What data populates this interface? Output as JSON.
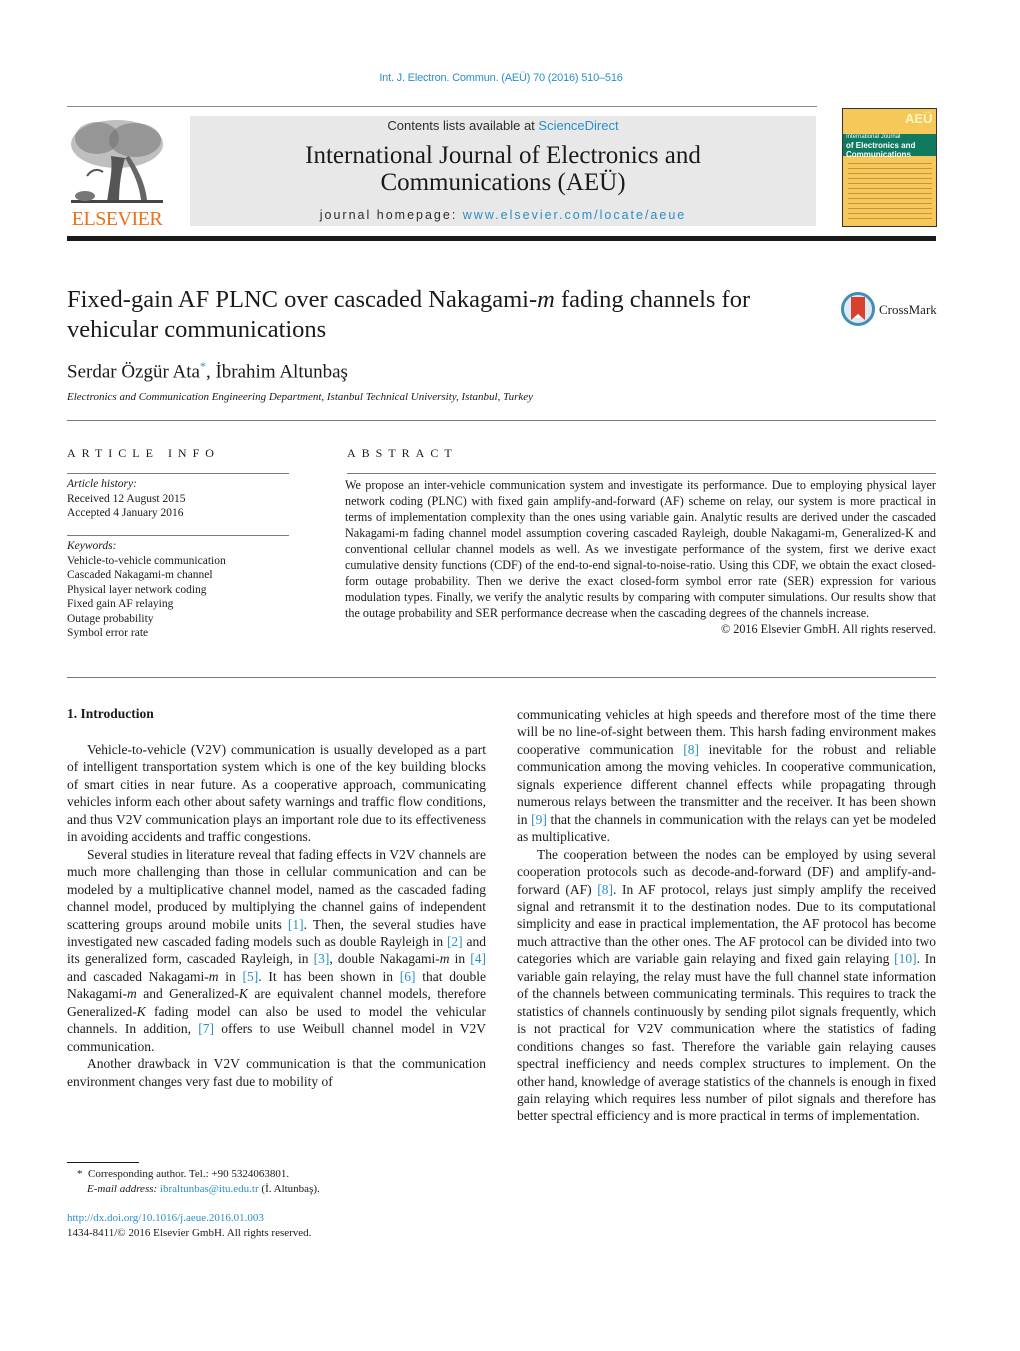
{
  "header": {
    "citation": "Int. J. Electron. Commun. (AEÜ) 70 (2016) 510–516",
    "contents_prefix": "Contents lists available at ",
    "contents_link": "ScienceDirect",
    "journal_title_line1": "International Journal of Electronics and",
    "journal_title_line2": "Communications (AEÜ)",
    "homepage_prefix": "journal homepage: ",
    "homepage_link": "www.elsevier.com/locate/aeue",
    "publisher_logo_text": "ELSEVIER",
    "cover": {
      "badge": "AEÜ",
      "title_line1": "International Journal",
      "title_line2": "of Electronics and",
      "title_line3": "Communications"
    },
    "colors": {
      "link": "#2a8fc7",
      "elsevier_orange": "#e9711c",
      "banner_bg": "#e8e8e8",
      "cover_yellow": "#f6c85a",
      "cover_green": "#0f7a5f",
      "crossmark_red": "#d9412f",
      "crossmark_ring": "#3f8fb8"
    }
  },
  "article": {
    "title_part1": "Fixed-gain AF PLNC over cascaded Nakagami-",
    "title_italic": "m",
    "title_part2": " fading channels for vehicular communications",
    "crossmark_label": "CrossMark",
    "author1": "Serdar Özgür Ata",
    "author1_mark": "*",
    "author_sep": ", ",
    "author2": "İbrahim Altunbaş",
    "affiliation": "Electronics and Communication Engineering Department, Istanbul Technical University, Istanbul, Turkey"
  },
  "article_info": {
    "heading": "ARTICLE INFO",
    "history_label": "Article history:",
    "received": "Received 12 August 2015",
    "accepted": "Accepted 4 January 2016",
    "keywords_label": "Keywords:",
    "keywords": [
      "Vehicle-to-vehicle communication",
      "Cascaded Nakagami-m channel",
      "Physical layer network coding",
      "Fixed gain AF relaying",
      "Outage probability",
      "Symbol error rate"
    ]
  },
  "abstract": {
    "heading": "ABSTRACT",
    "text": "We propose an inter-vehicle communication system and investigate its performance. Due to employing physical layer network coding (PLNC) with fixed gain amplify-and-forward (AF) scheme on relay, our system is more practical in terms of implementation complexity than the ones using variable gain. Analytic results are derived under the cascaded Nakagami-m fading channel model assumption covering cascaded Rayleigh, double Nakagami-m, Generalized-K and conventional cellular channel models as well. As we investigate performance of the system, first we derive exact cumulative density functions (CDF) of the end-to-end signal-to-noise-ratio. Using this CDF, we obtain the exact closed-form outage probability. Then we derive the exact closed-form symbol error rate (SER) expression for various modulation types. Finally, we verify the analytic results by comparing with computer simulations. Our results show that the outage probability and SER performance decrease when the cascading degrees of the channels increase.",
    "copyright": "© 2016 Elsevier GmbH. All rights reserved."
  },
  "introduction": {
    "heading": "1.  Introduction",
    "left_column": [
      "Vehicle-to-vehicle (V2V) communication is usually developed as a part of intelligent transportation system which is one of the key building blocks of smart cities in near future. As a cooperative approach, communicating vehicles inform each other about safety warnings and traffic flow conditions, and thus V2V communication plays an important role due to its effectiveness in avoiding accidents and traffic congestions.",
      "Several studies in literature reveal that fading effects in V2V channels are much more challenging than those in cellular communication and can be modeled by a multiplicative channel model, named as the cascaded fading channel model, produced by multiplying the channel gains of independent scattering groups around mobile units [1]. Then, the several studies have investigated new cascaded fading models such as double Rayleigh in [2] and its generalized form, cascaded Rayleigh, in [3], double Nakagami-m in [4] and cascaded Nakagami-m in [5]. It has been shown in [6] that double Nakagami-m and Generalized-K are equivalent channel models, therefore Generalized-K fading model can also be used to model the vehicular channels. In addition, [7] offers to use Weibull channel model in V2V communication.",
      "Another drawback in V2V communication is that the communication environment changes very fast due to mobility of"
    ],
    "right_column": [
      "communicating vehicles at high speeds and therefore most of the time there will be no line-of-sight between them. This harsh fading environment makes cooperative communication [8] inevitable for the robust and reliable communication among the moving vehicles. In cooperative communication, signals experience different channel effects while propagating through numerous relays between the transmitter and the receiver. It has been shown in [9] that the channels in communication with the relays can yet be modeled as multiplicative.",
      "The cooperation between the nodes can be employed by using several cooperation protocols such as decode-and-forward (DF) and amplify-and-forward (AF) [8]. In AF protocol, relays just simply amplify the received signal and retransmit it to the destination nodes. Due to its computational simplicity and ease in practical implementation, the AF protocol has become much attractive than the other ones. The AF protocol can be divided into two categories which are variable gain relaying and fixed gain relaying [10]. In variable gain relaying, the relay must have the full channel state information of the channels between communicating terminals. This requires to track the statistics of channels continuously by sending pilot signals frequently, which is not practical for V2V communication where the statistics of fading conditions changes so fast. Therefore the variable gain relaying causes spectral inefficiency and needs complex structures to implement. On the other hand, knowledge of average statistics of the channels is enough in fixed gain relaying which requires less number of pilot signals and therefore has better spectral efficiency and is more practical in terms of implementation."
    ]
  },
  "footnote": {
    "mark": "*",
    "corresponding": "Corresponding author. Tel.: +90 5324063801.",
    "email_label": "E-mail address: ",
    "email": "ibraltunbas@itu.edu.tr",
    "email_owner": " (İ. Altunbaş).",
    "doi": "http://dx.doi.org/10.1016/j.aeue.2016.01.003",
    "issn_line": "1434-8411/© 2016 Elsevier GmbH. All rights reserved."
  }
}
